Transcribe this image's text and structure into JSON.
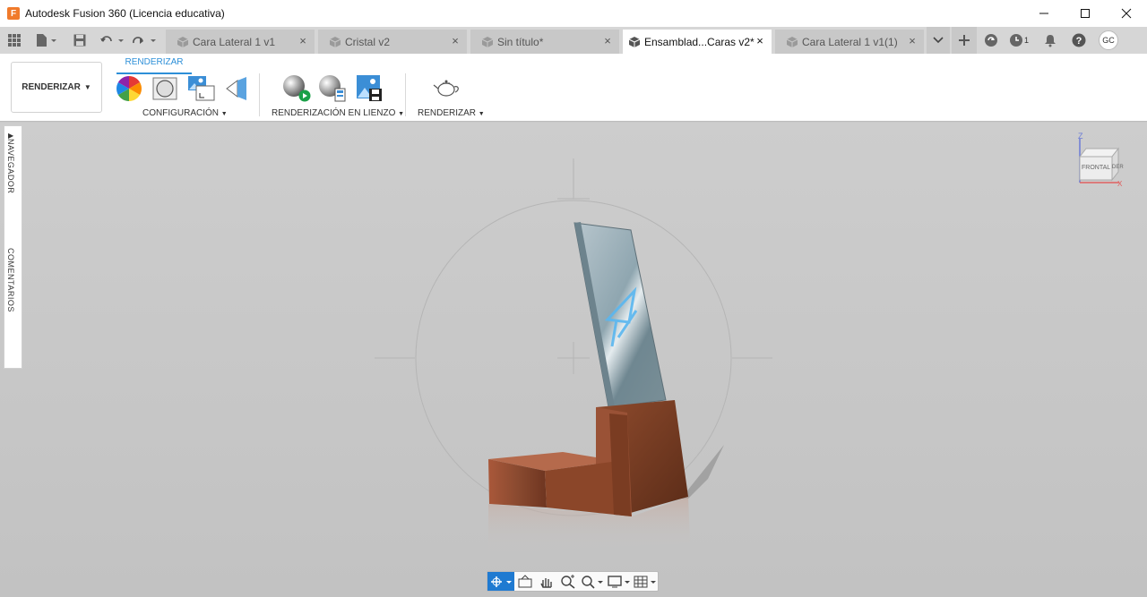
{
  "window": {
    "title": "Autodesk Fusion 360 (Licencia educativa)",
    "app_logo_letter": "F"
  },
  "tabs": [
    {
      "label": "Cara Lateral 1 v1",
      "active": false
    },
    {
      "label": "Cristal v2",
      "active": false
    },
    {
      "label": "Sin título*",
      "active": false
    },
    {
      "label": "Ensamblad...Caras v2*",
      "active": true
    },
    {
      "label": "Cara Lateral 1 v1(1)",
      "active": false
    }
  ],
  "tab_close_glyph": "×",
  "header_tools": {
    "jobs_count": "1",
    "user_initials": "GC"
  },
  "toolbar": {
    "workspace_label": "RENDERIZAR",
    "workspace_tab": "RENDERIZAR",
    "groups": {
      "configuracion": "CONFIGURACIÓN",
      "renderizacion_en_lienzo": "RENDERIZACIÓN EN LIENZO",
      "renderizar": "RENDERIZAR"
    }
  },
  "side_panel": {
    "navegador": "NAVEGADOR",
    "comentarios": "COMENTARIOS"
  },
  "viewcube": {
    "front_label": "FRONTAL",
    "right_label": "DER",
    "z_axis": "Z",
    "x_axis": "X"
  },
  "colors": {
    "accent": "#2d8fd8",
    "wood": "#8a4a30",
    "glass": "#8fa6b0",
    "nav_active": "#1f7ad1"
  }
}
